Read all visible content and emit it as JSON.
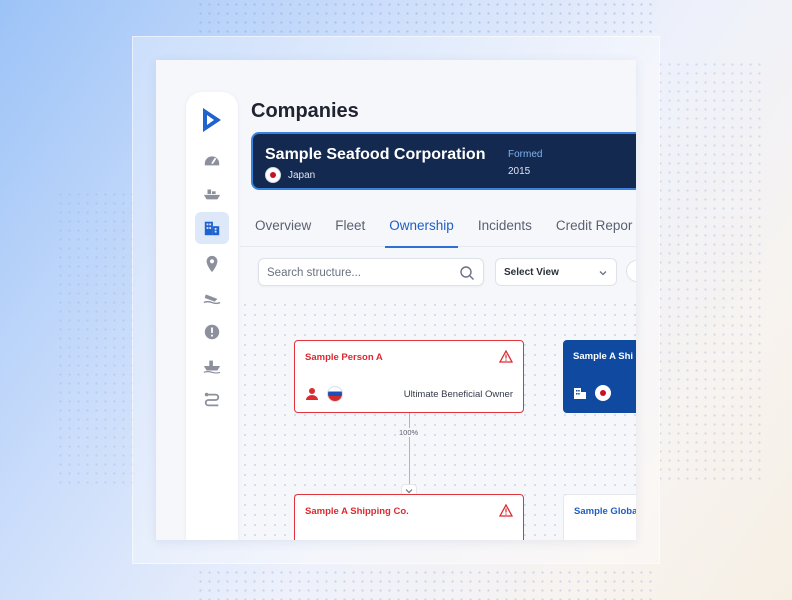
{
  "page": {
    "title": "Companies"
  },
  "sidebar": {
    "items": [
      {
        "name": "dashboard",
        "icon": "speedometer-icon"
      },
      {
        "name": "fleet",
        "icon": "ship-icon"
      },
      {
        "name": "companies",
        "icon": "building-icon",
        "active": true
      },
      {
        "name": "locations",
        "icon": "map-pin-icon"
      },
      {
        "name": "incidents",
        "icon": "sinking-ship-icon"
      },
      {
        "name": "alerts",
        "icon": "alert-octagon-icon"
      },
      {
        "name": "vessels",
        "icon": "cargo-ship-icon"
      },
      {
        "name": "routes",
        "icon": "route-icon"
      }
    ]
  },
  "company": {
    "name": "Sample Seafood Corporation",
    "country": "Japan",
    "formed_label": "Formed",
    "formed_value": "2015"
  },
  "tabs": [
    {
      "label": "Overview"
    },
    {
      "label": "Fleet"
    },
    {
      "label": "Ownership",
      "active": true
    },
    {
      "label": "Incidents"
    },
    {
      "label": "Credit Repor"
    }
  ],
  "toolbar": {
    "search_placeholder": "Search structure...",
    "select_view_label": "Select View"
  },
  "graph": {
    "nodes": {
      "person": {
        "title": "Sample Person A",
        "role": "Ultimate Beneficial Owner"
      },
      "ship_blue": {
        "title": "Sample A Shi"
      },
      "shipping": {
        "title": "Sample A  Shipping Co."
      },
      "global": {
        "title": "Sample Globa"
      }
    },
    "edge_label": "100%"
  },
  "colors": {
    "accent": "#2f6fd8",
    "banner": "#14294f",
    "alert_red": "#e0333b",
    "node_blue": "#0f4aa0"
  }
}
